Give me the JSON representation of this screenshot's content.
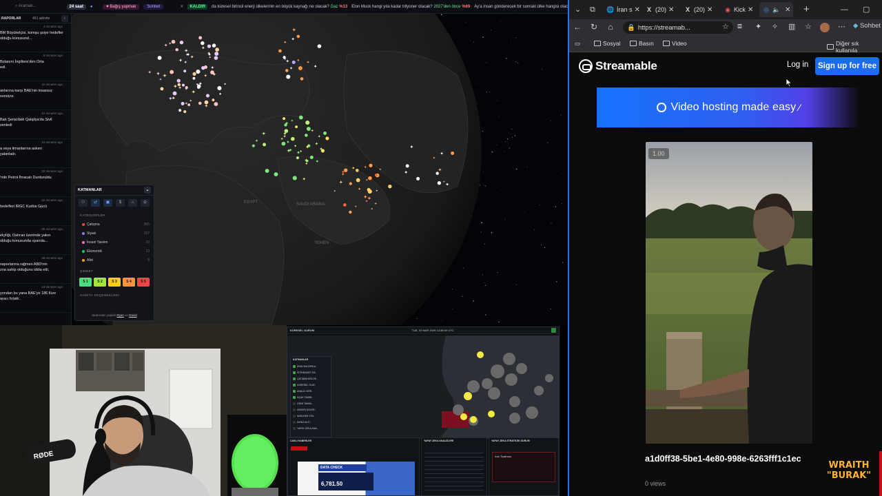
{
  "dashboard": {
    "topbar": {
      "search_placeholder": "Aramak...",
      "timeframe": "24 saat",
      "support": "Bağış yapmak",
      "sohbet": "Sohbet",
      "live": "KALDIR",
      "ticker1": "da küresel birincil enerji ülkelerinin en büyük kaynağı ne olacak?",
      "ticker1_tag": "Gaz",
      "ticker1_val": "%13",
      "ticker2": "Elon Musk hangi yıla kadar trilyoner olacak?",
      "ticker2_tag": "2027'den önce",
      "ticker2_val": "%69",
      "ticker3": "Ay'a insan gönderecek bir sonraki ülke hangisi olac"
    },
    "feed": {
      "title": "RAPORLAR",
      "count": "461 aktivite",
      "items": [
        {
          "time": "4 minutes ago",
          "text": "BM Büyükelçisi, komşu şsiye hedefler olduğu konusund..."
        },
        {
          "time": "9 minutes ago",
          "text": "Bolanını İngiltere'den Orta\nedi."
        },
        {
          "time": "11 minutes ago",
          "text": "anlarına karşı BAE'nin insansız\nsunuyor."
        },
        {
          "time": "12 minutes ago",
          "text": "Batı Şeria'daki Qalqilya'da Sivil\nzenledi"
        },
        {
          "time": "16 minutes ago",
          "text": "a veya limanlarına askeri\nyalanladı."
        },
        {
          "time": "20 minutes ago",
          "text": "'nde Petrol İhracatı Durduruldu"
        },
        {
          "time": "32 minutes ago",
          "text": "hedefleri IRGC Kudüs Gücü"
        },
        {
          "time": "36 minutes ago",
          "text": "elçiliği, Dahran üzerinde yakın\nolduğu konusunda uyarıda..."
        },
        {
          "time": "38 minutes ago",
          "text": "saporlarına rağmen ABD'nin\nzna sahip olduğunu iddia etti."
        },
        {
          "time": "43 minutes ago",
          "text": "yondan bu yana BAE'ye 186 füze\naracı fırlattı."
        }
      ]
    },
    "map": {
      "label_egypt": "EGYPT",
      "label_saudi": "SAUDI ARABIA",
      "label_yemen": "YEMEN"
    },
    "layers": {
      "title": "KATMANLAR",
      "cat_title": "KATEGORİLER",
      "categories": [
        {
          "name": "Çatışma",
          "count": "355",
          "color": "#ef4444"
        },
        {
          "name": "Siyasi",
          "count": "107",
          "color": "#8b7cf6"
        },
        {
          "name": "İnsani Yardım",
          "count": "10",
          "color": "#f472b6"
        },
        {
          "name": "Ekonomik",
          "count": "13",
          "color": "#22c55e"
        },
        {
          "name": "Afet",
          "count": "8",
          "color": "#f59e0b"
        }
      ],
      "sev_title": "ŞİDDET",
      "severity": [
        {
          "label": "S 1",
          "color": "#4ade80"
        },
        {
          "label": "S 2",
          "color": "#a3e635"
        },
        {
          "label": "S 3",
          "color": "#facc15"
        },
        {
          "label": "S 4",
          "color": "#fb923c"
        },
        {
          "label": "S 5",
          "color": "#ef4444"
        }
      ],
      "map_title": "HARİTA SEÇENEKLERİ",
      "footer_prefix": "tarafından yapıldı",
      "footer_author1": "Ryan",
      "footer_and": "ve",
      "footer_author2": "David"
    }
  },
  "mini": {
    "title": "KÜRESEL DURUM",
    "date": "TUE, 03 MAR 2026 13:38:40 UTC",
    "layers_title": "KATMANLAR",
    "list": [
      "İRAN SALDIRILA..",
      "İSTİHBARAT SIC..",
      "ÇATIŞMA BÖLGE..",
      "KÜRESEL OLAY..",
      "ANALİZ VERİ..",
      "UÇAK TAKIBI..",
      "GEMI TAKIBI..",
      "ASKERI ÜSLER..",
      "NÜKLEER TES..",
      "DENİZ ALTI..",
      "YAPAY ZEKA ANA.."
    ],
    "panel1": "CANLI HABERLER",
    "panel2": "YAPAY ZEKA ANALİZLERİ",
    "panel3": "YAPAY ZEKA STRATEJİK DURUM",
    "data_check": "DATA CHECK",
    "price": "6,781.50",
    "iran": "İran Tiyatrosu"
  },
  "browser": {
    "tabs": [
      "İran s",
      "(20)",
      "(20)",
      "Kick",
      ""
    ],
    "url": "https://streamab...",
    "bookmarks": [
      "Sosyal",
      "Basın",
      "Video"
    ],
    "bookmarks_other": "Diğer sık kullanıla",
    "sohbet": "Sohbet",
    "page": {
      "brand": "Streamable",
      "login": "Log in",
      "signup": "Sign up for free",
      "banner": "Video hosting made easy",
      "speed": "1.00",
      "title": "a1d0ff38-5be1-4e80-998e-6263fff1c1ec",
      "views": "0 views"
    }
  },
  "overlay": {
    "line1": "WRAITH",
    "line2": "\"BURAK\""
  }
}
